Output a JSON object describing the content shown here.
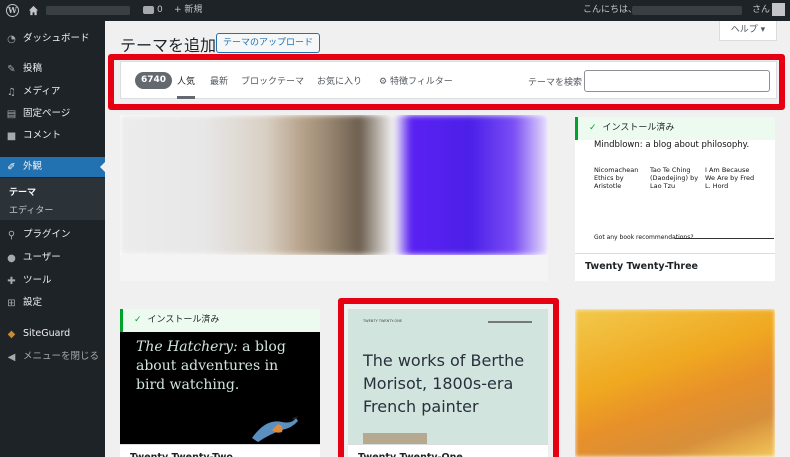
{
  "adminbar": {
    "comment_count": "0",
    "new_label": "+ 新規",
    "greeting": "こんにちは、",
    "honorific": "さん"
  },
  "sidebar": {
    "items": [
      {
        "label": "ダッシュボード",
        "icon": "dashboard-icon"
      },
      {
        "label": "投稿",
        "icon": "pin-icon"
      },
      {
        "label": "メディア",
        "icon": "media-icon"
      },
      {
        "label": "固定ページ",
        "icon": "page-icon"
      },
      {
        "label": "コメント",
        "icon": "comment-icon"
      },
      {
        "label": "外観",
        "icon": "brush-icon"
      },
      {
        "label": "プラグイン",
        "icon": "plugin-icon"
      },
      {
        "label": "ユーザー",
        "icon": "user-icon"
      },
      {
        "label": "ツール",
        "icon": "wrench-icon"
      },
      {
        "label": "設定",
        "icon": "settings-icon"
      },
      {
        "label": "SiteGuard",
        "icon": "siteguard-icon"
      },
      {
        "label": "メニューを閉じる",
        "icon": "collapse-icon"
      }
    ],
    "submenu": [
      "テーマ",
      "エディター"
    ]
  },
  "header": {
    "title": "テーマを追加",
    "upload_label": "テーマのアップロード",
    "help_label": "ヘルプ ▾"
  },
  "filter": {
    "count": "6740",
    "tabs": [
      "人気",
      "最新",
      "ブロックテーマ",
      "お気に入り",
      "特徴フィルター"
    ],
    "search_label": "テーマを検索",
    "search_value": ""
  },
  "themes": {
    "installed_label": "インストール済み",
    "tt3": {
      "name": "Twenty Twenty-Three",
      "headline": "Mindblown: a blog about philosophy.",
      "books": [
        "Nicomachean Ethics by Aristotle",
        "Tao Te Ching (Daodejing) by Lao Tzu",
        "I Am Because We Are by Fred L. Hord"
      ],
      "footer_text": "Got any book recommendations?"
    },
    "tt2": {
      "name": "Twenty Twenty-Two",
      "text_italic": "The Hatchery:",
      "text_rest": " a blog about adventures in bird watching."
    },
    "tt1": {
      "name": "Twenty Twenty-One",
      "site_title": "TWENTY TWENTY-ONE",
      "text": "The works of Berthe Morisot, 1800s-era French painter"
    }
  }
}
